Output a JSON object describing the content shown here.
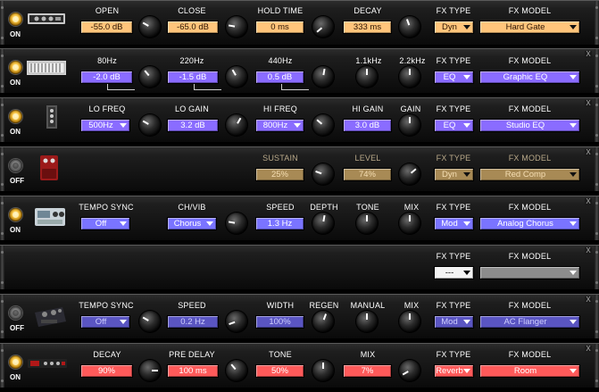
{
  "slots": [
    {
      "power_label": "ON",
      "power_state": "on",
      "open_label": "OPEN",
      "open_value": "-55.0 dB",
      "close_label": "CLOSE",
      "close_value": "-65.0 dB",
      "hold_label": "HOLD TIME",
      "hold_value": "0 ms",
      "decay_label": "DECAY",
      "decay_value": "333 ms",
      "fx_type_label": "FX TYPE",
      "fx_type_value": "Dyn",
      "fx_model_label": "FX MODEL",
      "fx_model_value": "Hard Gate"
    },
    {
      "power_label": "ON",
      "power_state": "on",
      "b1_label": "80Hz",
      "b1_value": "-2.0 dB",
      "b2_label": "220Hz",
      "b2_value": "-1.5 dB",
      "b3_label": "440Hz",
      "b3_value": "0.5 dB",
      "b4_label": "1.1kHz",
      "b5_label": "2.2kHz",
      "fx_type_label": "FX TYPE",
      "fx_type_value": "EQ",
      "fx_model_label": "FX MODEL",
      "fx_model_value": "Graphic EQ",
      "close_glyph": "X"
    },
    {
      "power_label": "ON",
      "power_state": "on",
      "lofreq_label": "LO FREQ",
      "lofreq_value": "500Hz",
      "logain_label": "LO GAIN",
      "logain_value": "3.2 dB",
      "hifreq_label": "HI FREQ",
      "hifreq_value": "800Hz",
      "higain_label": "HI GAIN",
      "higain_value": "3.0 dB",
      "gain_label": "GAIN",
      "fx_type_label": "FX TYPE",
      "fx_type_value": "EQ",
      "fx_model_label": "FX MODEL",
      "fx_model_value": "Studio EQ",
      "close_glyph": "X"
    },
    {
      "power_label": "OFF",
      "power_state": "off",
      "sustain_label": "SUSTAIN",
      "sustain_value": "25%",
      "level_label": "LEVEL",
      "level_value": "74%",
      "fx_type_label": "FX TYPE",
      "fx_type_value": "Dyn",
      "fx_model_label": "FX MODEL",
      "fx_model_value": "Red Comp",
      "close_glyph": "X"
    },
    {
      "power_label": "ON",
      "power_state": "on",
      "tempo_label": "TEMPO SYNC",
      "tempo_value": "Off",
      "chvib_label": "CH/VIB",
      "chvib_value": "Chorus",
      "speed_label": "SPEED",
      "speed_value": "1.3 Hz",
      "depth_label": "DEPTH",
      "tone_label": "TONE",
      "mix_label": "MIX",
      "fx_type_label": "FX TYPE",
      "fx_type_value": "Mod",
      "fx_model_label": "FX MODEL",
      "fx_model_value": "Analog Chorus",
      "close_glyph": "X"
    },
    {
      "fx_type_label": "FX TYPE",
      "fx_type_value": "---",
      "fx_model_label": "FX MODEL",
      "fx_model_value": "",
      "close_glyph": "X"
    },
    {
      "power_label": "OFF",
      "power_state": "off",
      "tempo_label": "TEMPO SYNC",
      "tempo_value": "Off",
      "speed_label": "SPEED",
      "speed_value": "0.2 Hz",
      "width_label": "WIDTH",
      "width_value": "100%",
      "regen_label": "REGEN",
      "manual_label": "MANUAL",
      "mix_label": "MIX",
      "fx_type_label": "FX TYPE",
      "fx_type_value": "Mod",
      "fx_model_label": "FX MODEL",
      "fx_model_value": "AC Flanger",
      "close_glyph": "X"
    },
    {
      "power_label": "ON",
      "power_state": "on",
      "decay_label": "DECAY",
      "decay_value": "90%",
      "predelay_label": "PRE DELAY",
      "predelay_value": "100 ms",
      "tone_label": "TONE",
      "tone_value": "50%",
      "mix_label": "MIX",
      "mix_value": "7%",
      "fx_type_label": "FX TYPE",
      "fx_type_value": "Reverb",
      "fx_model_label": "FX MODEL",
      "fx_model_value": "Room",
      "close_glyph": "X"
    }
  ],
  "colors": {
    "dynamics_accent": "#ffc57b",
    "eq_accent": "#8a6cff",
    "mod_accent": "#7a74ff",
    "reverb_accent": "#ff5a5a"
  }
}
